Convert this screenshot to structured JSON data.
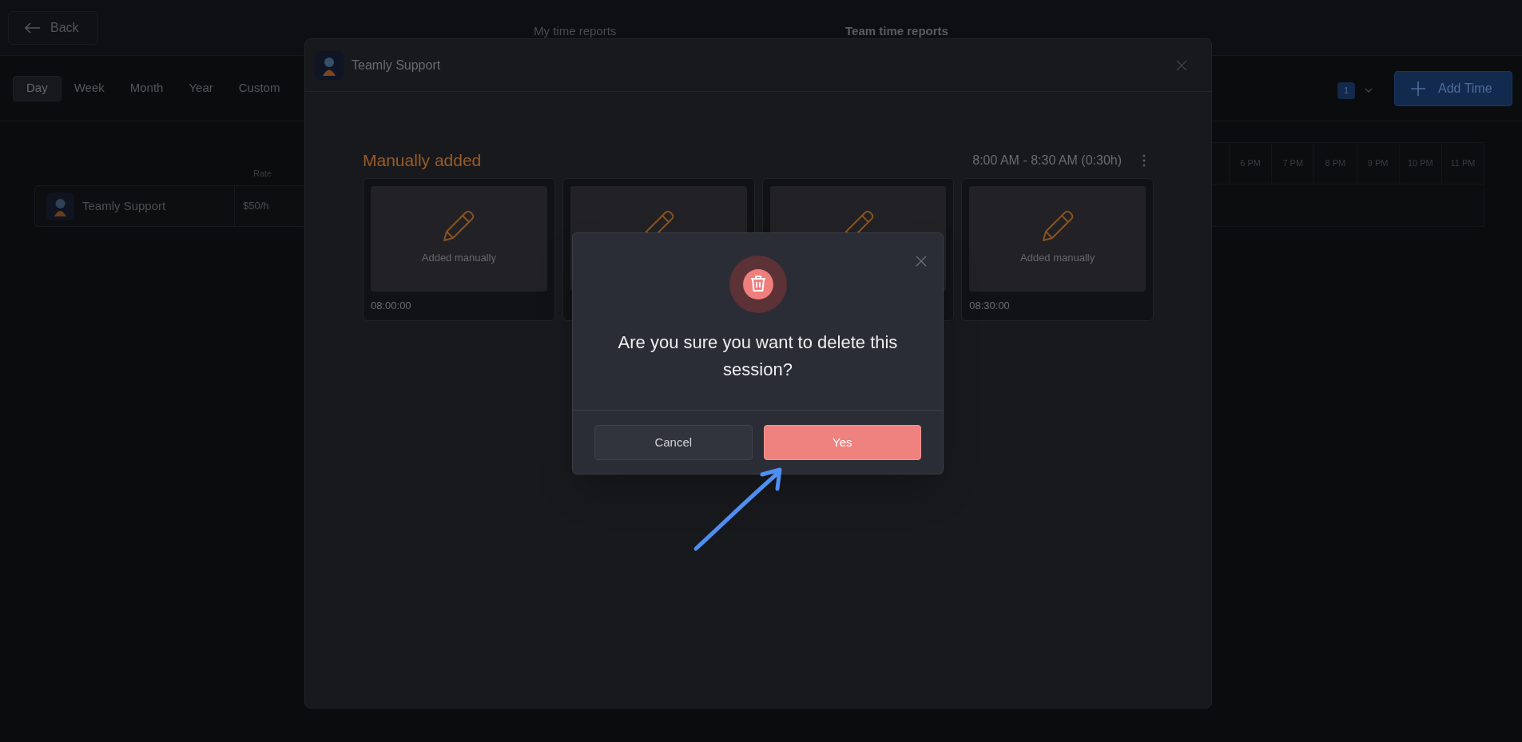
{
  "header": {
    "back": "Back",
    "tabs": [
      {
        "label": "My time reports",
        "selected": false
      },
      {
        "label": "Team time reports",
        "selected": true
      }
    ]
  },
  "periods": [
    {
      "label": "Day",
      "selected": true
    },
    {
      "label": "Week",
      "selected": false
    },
    {
      "label": "Month",
      "selected": false
    },
    {
      "label": "Year",
      "selected": false
    },
    {
      "label": "Custom",
      "selected": false
    }
  ],
  "filter": {
    "count": "1"
  },
  "add_button": "Add Time",
  "table": {
    "rate_header": "Rate",
    "rows": [
      {
        "name": "Teamly Support",
        "rate": "$50/h"
      }
    ]
  },
  "timeline": {
    "hours": [
      "6 PM",
      "7 PM",
      "8 PM",
      "9 PM",
      "10 PM",
      "11 PM"
    ]
  },
  "session_modal": {
    "title": "Teamly Support",
    "section": "Manually added",
    "time_range": "8:00 AM - 8:30 AM (0:30h)",
    "cards": [
      {
        "kind": "manual",
        "label": "Added manually",
        "time": "08:00:00"
      },
      {
        "kind": "manual"
      },
      {
        "kind": "manual"
      },
      {
        "kind": "manual",
        "label": "Added manually",
        "time": "08:30:00"
      }
    ]
  },
  "confirm_dialog": {
    "message": "Are you sure you want to delete this session?",
    "buttons": [
      {
        "label": "Cancel",
        "kind": "secondary"
      },
      {
        "label": "Yes",
        "kind": "danger"
      }
    ]
  }
}
